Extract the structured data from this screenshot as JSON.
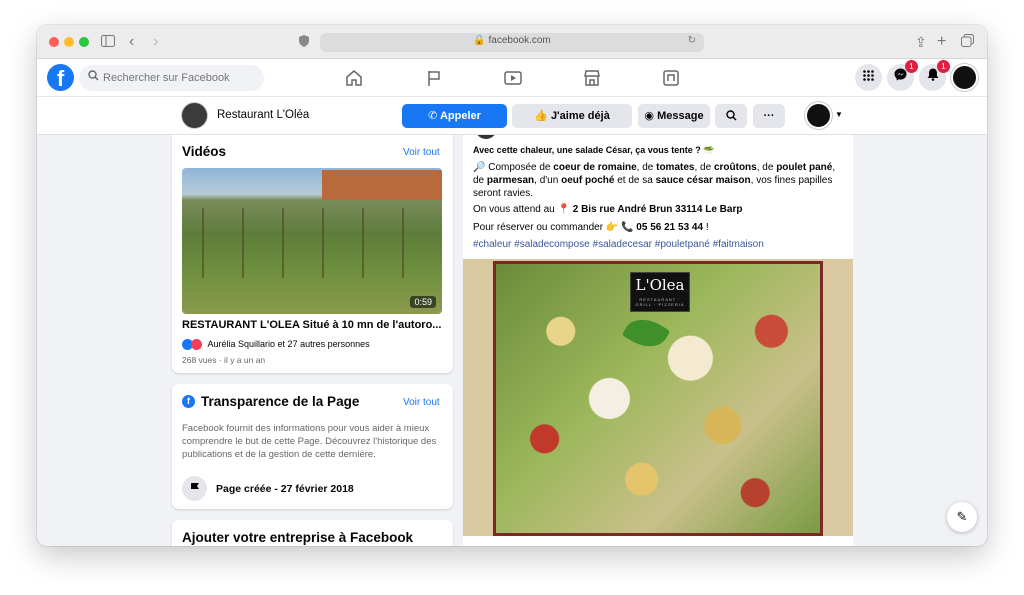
{
  "browser": {
    "url": "facebook.com",
    "traffic_lights": [
      "#ff5f57",
      "#febc2e",
      "#28c840"
    ]
  },
  "nav": {
    "search_placeholder": "Rechercher sur Facebook",
    "messenger_badge": "1",
    "notifications_badge": "1",
    "icons": [
      "home-icon",
      "pages-flag-icon",
      "watch-icon",
      "marketplace-icon",
      "gaming-icon"
    ]
  },
  "page_header": {
    "name": "Restaurant L'Oléa",
    "call_label": "Appeler",
    "like_label": "J'aime déjà",
    "message_label": "Message"
  },
  "videos_card": {
    "title": "Vidéos",
    "see_all": "Voir tout",
    "duration": "0:59",
    "video_title": "RESTAURANT L'OLEA Situé à 10 mn de l'autoro...",
    "reactions": "Aurélia Squillario et 27 autres personnes",
    "meta": "268 vues · il y a un an"
  },
  "transparency_card": {
    "title": "Transparence de la Page",
    "see_all": "Voir tout",
    "description": "Facebook fournit des informations pour vous aider à mieux comprendre le but de cette Page. Découvrez l'historique des publications et de la gestion de cette dernière.",
    "created": "Page créée - 27 février 2018"
  },
  "business_card": {
    "title": "Ajouter votre entreprise à Facebook"
  },
  "post": {
    "line1_a": "Avec cette chaleur, une salade César, ça vous tente ? ",
    "line1_emoji": "🥗",
    "line2_icon": "🔎",
    "line2_a": " Composée de ",
    "line2_b": "coeur de romaine",
    "line2_c": ", de ",
    "line2_d": "tomates",
    "line2_e": ", de ",
    "line2_f": "croûtons",
    "line2_g": ", de ",
    "line2_h": "poulet pané",
    "line2_i": ", de ",
    "line2_j": "parmesan",
    "line2_k": ", d'un ",
    "line2_l": "oeuf poché",
    "line2_m": " et de sa ",
    "line2_n": "sauce césar maison",
    "line2_o": ", vos fines papilles seront ravies.",
    "line3_a": "On vous attend au ",
    "line3_pin": "📍",
    "line3_b": " 2 Bis rue André Brun 33114 Le Barp",
    "line4_a": "Pour réserver ou commander ",
    "line4_emojis": "👉 📞",
    "line4_b": " 05 56 21 53 44",
    "line4_c": " !",
    "hashtags": "#chaleur #saladecompose #saladecesar #pouletpané #faitmaison",
    "photo_logo": "L'Olea",
    "photo_logo_sub": "RESTAURANT · GRILL · PIZZERIA"
  }
}
